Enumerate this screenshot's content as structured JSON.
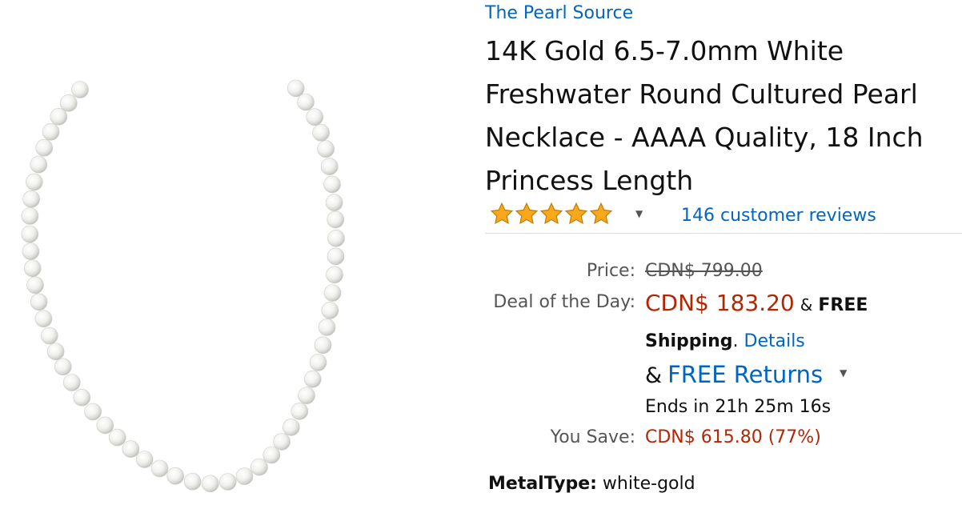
{
  "product": {
    "brand": "The Pearl Source",
    "title": "14K Gold 6.5-7.0mm White Freshwater Round Cultured Pearl Necklace - AAAA Quality, 18 Inch Princess Length",
    "image_alt": "white pearl necklace"
  },
  "rating": {
    "stars": 5,
    "max_stars": 5,
    "reviews_text": "146 customer reviews",
    "star_color": "#f7a81b"
  },
  "pricing": {
    "price_label": "Price:",
    "list_price": "CDN$ 799.00",
    "deal_label": "Deal of the Day:",
    "deal_price": "CDN$ 183.20",
    "amp_1": "&",
    "free_shipping_1": "FREE",
    "free_shipping_2": "Shipping",
    "period": ".",
    "details_link": "Details",
    "amp_2": "&",
    "free_returns": "FREE Returns",
    "ends_in": "Ends in 21h 25m 16s",
    "save_label": "You Save:",
    "save_value": "CDN$ 615.80 (77%)"
  },
  "attributes": {
    "metal_label": "MetalType:",
    "metal_value": "white-gold"
  },
  "colors": {
    "link": "#0066c0",
    "price": "#b12704"
  }
}
